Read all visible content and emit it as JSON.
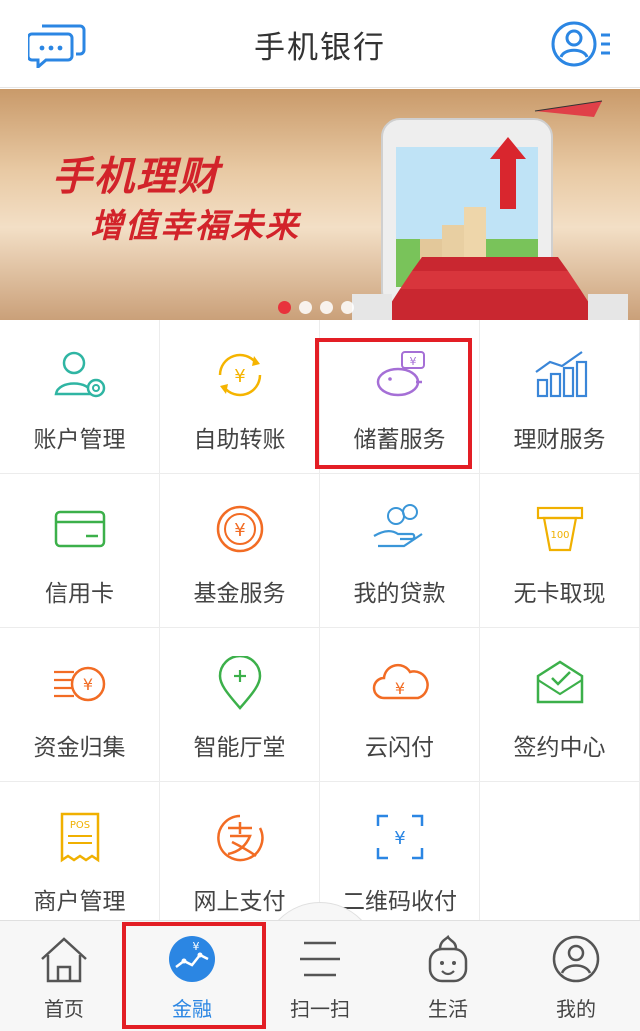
{
  "header": {
    "title": "手机银行"
  },
  "banner": {
    "headline": "手机理财",
    "subline": "增值幸福未来",
    "dots_count": 4,
    "active_dot": 1
  },
  "services": [
    {
      "label": "账户管理",
      "icon": "account-settings-icon",
      "color": "#2fb5a3"
    },
    {
      "label": "自助转账",
      "icon": "yuan-transfer-icon",
      "color": "#f5b400"
    },
    {
      "label": "储蓄服务",
      "icon": "piggy-bank-icon",
      "color": "#a56fd6"
    },
    {
      "label": "理财服务",
      "icon": "bar-chart-icon",
      "color": "#3a86d8"
    },
    {
      "label": "信用卡",
      "icon": "credit-card-icon",
      "color": "#3cb04a"
    },
    {
      "label": "基金服务",
      "icon": "yuan-coin-icon",
      "color": "#f26c24"
    },
    {
      "label": "我的贷款",
      "icon": "hand-coins-icon",
      "color": "#3a96d8"
    },
    {
      "label": "无卡取现",
      "icon": "cash-note-icon",
      "color": "#f0b000"
    },
    {
      "label": "资金归集",
      "icon": "funds-collect-icon",
      "color": "#f26c24"
    },
    {
      "label": "智能厅堂",
      "icon": "location-pin-icon",
      "color": "#3cb04a"
    },
    {
      "label": "云闪付",
      "icon": "cloud-pay-icon",
      "color": "#f26c24"
    },
    {
      "label": "签约中心",
      "icon": "envelope-check-icon",
      "color": "#3cb04a"
    },
    {
      "label": "商户管理",
      "icon": "pos-receipt-icon",
      "color": "#f0b000"
    },
    {
      "label": "网上支付",
      "icon": "alipay-icon",
      "color": "#f26c24"
    },
    {
      "label": "二维码收付",
      "icon": "qr-yuan-icon",
      "color": "#2b86e3"
    }
  ],
  "nav": {
    "items": [
      {
        "label": "首页",
        "icon": "home-icon",
        "active": false
      },
      {
        "label": "金融",
        "icon": "finance-trend-icon",
        "active": true
      },
      {
        "label": "扫一扫",
        "icon": "scan-icon",
        "active": false
      },
      {
        "label": "生活",
        "icon": "life-face-icon",
        "active": false
      },
      {
        "label": "我的",
        "icon": "profile-icon",
        "active": false
      }
    ]
  },
  "colors": {
    "accent": "#2b86e3",
    "highlight": "#e31e25",
    "banner_text": "#d2232a"
  }
}
